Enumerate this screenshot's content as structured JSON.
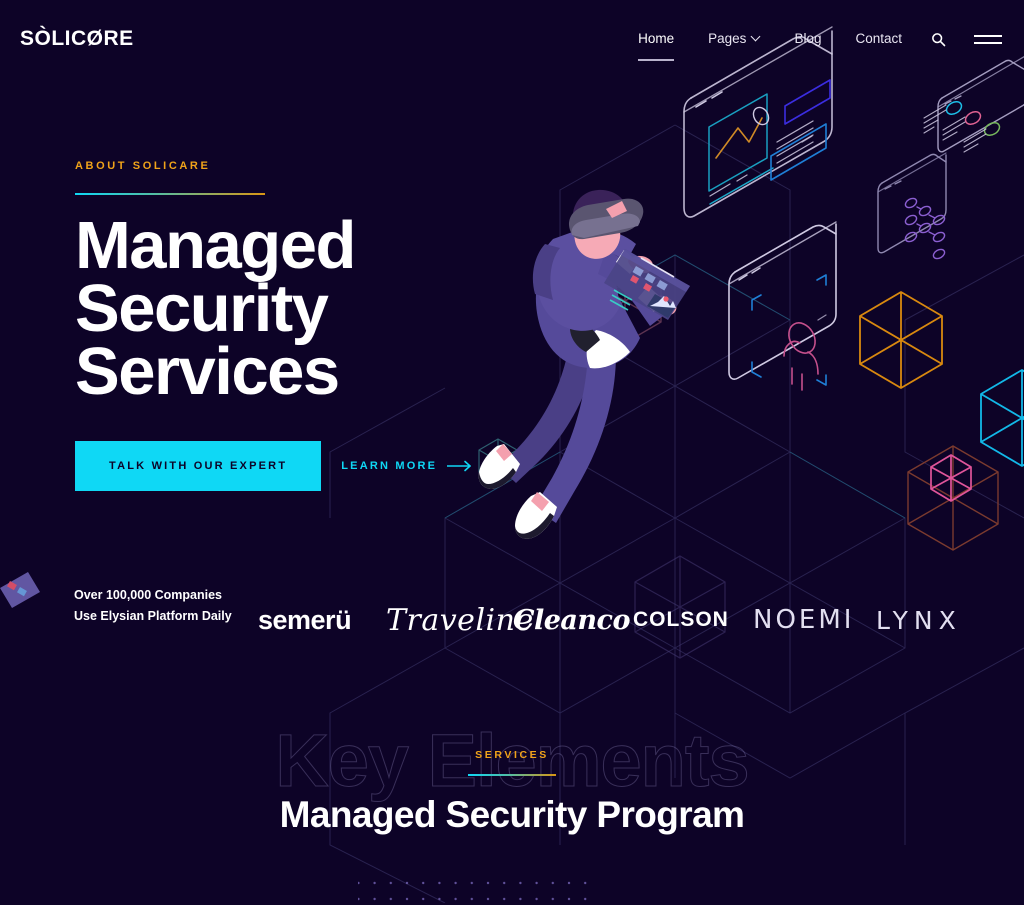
{
  "theme": {
    "background": "#0d0327",
    "accent_cyan": "#0fd8f5",
    "accent_orange": "#f0a31a",
    "text_primary": "#ffffff",
    "text_muted": "#e9e6f2"
  },
  "header": {
    "brand": "SÒLICØRE",
    "nav": [
      {
        "label": "Home",
        "active": true,
        "has_dropdown": false
      },
      {
        "label": "Pages",
        "active": false,
        "has_dropdown": true
      },
      {
        "label": "Blog",
        "active": false,
        "has_dropdown": false
      },
      {
        "label": "Contact",
        "active": false,
        "has_dropdown": false
      }
    ],
    "search_icon": "search-icon",
    "menu_icon": "hamburger-menu-icon"
  },
  "hero": {
    "eyebrow": "About Solicare",
    "title_line1": "Managed",
    "title_line2": "Security",
    "title_line3": "Services",
    "primary_button": "Talk With Our Expert",
    "secondary_link": "Learn More",
    "arrow_icon": "arrow-right-icon"
  },
  "clients": {
    "note_line1": "Over 100,000 Companies",
    "note_line2": "Use Elysian Platform Daily",
    "logos": [
      {
        "name": "semerü"
      },
      {
        "name": "Traveline"
      },
      {
        "name": "Cleanco"
      },
      {
        "name": "COLSON"
      },
      {
        "name": "NOEMI"
      },
      {
        "name": "LYNX"
      }
    ]
  },
  "services": {
    "watermark": "Key Elements",
    "label": "Services",
    "title": "Managed Security Program"
  }
}
